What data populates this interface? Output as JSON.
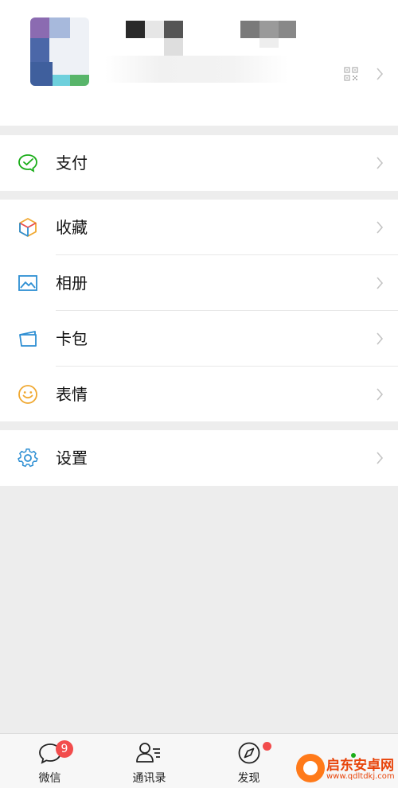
{
  "menu": {
    "pay": "支付",
    "favorites": "收藏",
    "album": "相册",
    "cards": "卡包",
    "stickers": "表情",
    "settings": "设置"
  },
  "tabbar": {
    "chats": "微信",
    "chats_badge": "9",
    "contacts": "通讯录",
    "discover": "发现"
  },
  "watermark": {
    "title": "启东安卓网",
    "url": "www.qdltdkj.com"
  },
  "colors": {
    "pay_icon": "#1aad19",
    "album_icon": "#2e8fd3",
    "cards_icon": "#2e8fd3",
    "stickers_icon": "#f0a830",
    "settings_icon": "#2e8fd3",
    "badge": "#f24c4c",
    "background": "#ededed"
  },
  "icons": [
    "qr-code-icon",
    "pay-icon",
    "favorites-cube-icon",
    "album-image-icon",
    "card-wallet-icon",
    "smiley-icon",
    "gear-icon",
    "chat-bubble-icon",
    "contacts-icon",
    "compass-icon",
    "chevron-right-icon"
  ]
}
